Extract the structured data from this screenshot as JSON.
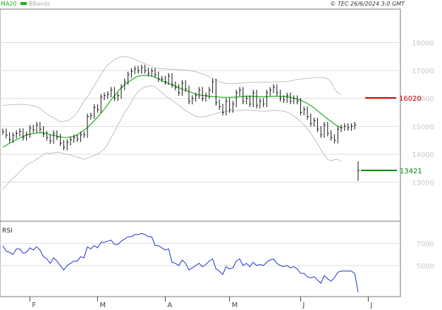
{
  "header": {
    "ma_label": "MA20",
    "bb_label": "BBands",
    "copyright": "© TEC 26/6/2024 3:0 GMT"
  },
  "colors": {
    "price": "#111111",
    "ma": "#1fb01f",
    "bands": "#c0c0c0",
    "rsi": "#2233cc",
    "resistance": "#cc0000",
    "support": "#008800",
    "grid": "#dddddd",
    "panel_border": "#777777"
  },
  "chart_data": [
    {
      "type": "line",
      "panel": "price",
      "y_ticks": [
        13000,
        14000,
        15000,
        16000,
        17000,
        18000
      ],
      "y_tick_labels": [
        "13000",
        "14000",
        "15000",
        "16000",
        "17000",
        "18000"
      ],
      "ylim": [
        11600,
        19200
      ],
      "month_labels": [
        {
          "label": "F",
          "index": 8
        },
        {
          "label": "M",
          "index": 28
        },
        {
          "label": "A",
          "index": 48
        },
        {
          "label": "M",
          "index": 67
        },
        {
          "label": "J",
          "index": 88
        },
        {
          "label": "J",
          "index": 108
        }
      ],
      "close": [
        14810,
        14680,
        14520,
        14670,
        14750,
        14820,
        14600,
        14700,
        14940,
        14880,
        15050,
        14900,
        14720,
        14600,
        14480,
        14750,
        14620,
        14400,
        14250,
        14430,
        14520,
        14600,
        14550,
        14700,
        14700,
        15350,
        15380,
        15680,
        15600,
        16050,
        16100,
        16150,
        16300,
        16020,
        16100,
        16400,
        16600,
        16850,
        16980,
        17060,
        17000,
        17100,
        17000,
        16900,
        16980,
        16850,
        16700,
        16700,
        16600,
        16800,
        16500,
        16400,
        16200,
        16550,
        16350,
        15900,
        16000,
        16100,
        16300,
        16000,
        16100,
        16300,
        16600,
        15850,
        15700,
        15500,
        15900,
        15600,
        15800,
        16200,
        16300,
        15900,
        16000,
        15800,
        16200,
        15750,
        15900,
        15800,
        16200,
        16300,
        16400,
        16200,
        16000,
        15950,
        16100,
        15900,
        16000,
        15900,
        15500,
        15600,
        15350,
        15100,
        15200,
        14900,
        14700,
        15050,
        14750,
        14600,
        14500,
        14900,
        14950,
        15000,
        14950,
        15000,
        15050,
        13421
      ],
      "ma20": [
        14250,
        14320,
        14400,
        14460,
        14520,
        14580,
        14640,
        14690,
        14720,
        14740,
        14760,
        14770,
        14770,
        14750,
        14700,
        14680,
        14650,
        14620,
        14600,
        14600,
        14620,
        14640,
        14700,
        14780,
        14860,
        14950,
        15080,
        15200,
        15330,
        15470,
        15620,
        15780,
        15950,
        16100,
        16250,
        16380,
        16500,
        16580,
        16660,
        16740,
        16800,
        16820,
        16830,
        16820,
        16800,
        16760,
        16700,
        16640,
        16580,
        16530,
        16490,
        16440,
        16390,
        16340,
        16290,
        16250,
        16200,
        16160,
        16130,
        16110,
        16090,
        16080,
        16070,
        16060,
        16050,
        16040,
        16040,
        16040,
        16045,
        16050,
        16060,
        16070,
        16080,
        16080,
        16080,
        16070,
        16060,
        16060,
        16060,
        16070,
        16080,
        16080,
        16080,
        16070,
        16060,
        16040,
        16010,
        15980,
        15940,
        15880,
        15820,
        15740,
        15660,
        15560,
        15460,
        15360,
        15260,
        15180,
        15080,
        15010,
        14950
      ],
      "upper_band": [
        15750,
        15760,
        15770,
        15780,
        15790,
        15790,
        15790,
        15770,
        15760,
        15740,
        15700,
        15640,
        15550,
        15450,
        15370,
        15310,
        15230,
        15170,
        15180,
        15200,
        15260,
        15350,
        15500,
        15700,
        15900,
        16050,
        16250,
        16450,
        16650,
        16850,
        17050,
        17200,
        17300,
        17400,
        17450,
        17500,
        17500,
        17480,
        17450,
        17400,
        17350,
        17300,
        17250,
        17200,
        17150,
        17100,
        17080,
        17070,
        17060,
        17050,
        17050,
        17040,
        17030,
        17020,
        17020,
        17000,
        16980,
        16960,
        16920,
        16880,
        16830,
        16770,
        16720,
        16670,
        16600,
        16560,
        16540,
        16530,
        16530,
        16540,
        16550,
        16560,
        16570,
        16580,
        16580,
        16580,
        16580,
        16580,
        16580,
        16580,
        16580,
        16590,
        16600,
        16600,
        16610,
        16630,
        16650,
        16680,
        16700,
        16700,
        16720,
        16730,
        16740,
        16750,
        16750,
        16740,
        16700,
        16600,
        16350,
        16200,
        16150
      ],
      "lower_band": [
        12750,
        12880,
        13030,
        13140,
        13250,
        13370,
        13490,
        13610,
        13680,
        13740,
        13820,
        13900,
        13990,
        14050,
        14030,
        14050,
        14070,
        14070,
        14020,
        14000,
        13980,
        13930,
        13900,
        13860,
        13820,
        13850,
        13910,
        13950,
        14010,
        14090,
        14190,
        14360,
        14600,
        14800,
        15050,
        15260,
        15500,
        15680,
        15870,
        16080,
        16250,
        16340,
        16410,
        16440,
        16450,
        16420,
        16320,
        16210,
        16100,
        16010,
        15930,
        15840,
        15750,
        15660,
        15560,
        15500,
        15420,
        15360,
        15340,
        15340,
        15350,
        15390,
        15420,
        15450,
        15500,
        15520,
        15540,
        15550,
        15560,
        15560,
        15570,
        15580,
        15590,
        15580,
        15580,
        15560,
        15540,
        15540,
        15540,
        15560,
        15580,
        15570,
        15560,
        15540,
        15510,
        15450,
        15370,
        15280,
        15180,
        15060,
        14920,
        14750,
        14580,
        14370,
        14170,
        13980,
        13820,
        13760,
        13810,
        13820,
        13750
      ],
      "resistance": {
        "value": 16020,
        "label": "16020"
      },
      "support": {
        "value": 13421,
        "label": "13421"
      }
    },
    {
      "type": "line",
      "panel": "rsi",
      "title": "RSI",
      "y_ticks": [
        50,
        70
      ],
      "y_tick_labels": [
        "5000",
        "7000"
      ],
      "ylim": [
        22,
        90
      ],
      "values": [
        68,
        63,
        62,
        60,
        65,
        65,
        61,
        62,
        66,
        64,
        67,
        64,
        58,
        56,
        52,
        57,
        54,
        50,
        46,
        50,
        52,
        54,
        54,
        58,
        57,
        67,
        65,
        68,
        66,
        71,
        71,
        72,
        73,
        69,
        69,
        72,
        74,
        76,
        76,
        78,
        78,
        79,
        78,
        76,
        76,
        68,
        68,
        66,
        64,
        65,
        53,
        52,
        50,
        55,
        52,
        46,
        48,
        50,
        52,
        49,
        51,
        54,
        56,
        47,
        45,
        42,
        49,
        47,
        48,
        54,
        56,
        50,
        52,
        49,
        53,
        50,
        51,
        50,
        53,
        55,
        56,
        52,
        50,
        49,
        50,
        48,
        49,
        47,
        43,
        43,
        40,
        39,
        40,
        37,
        34,
        41,
        38,
        36,
        39,
        44,
        45,
        45,
        45,
        45,
        43,
        26
      ]
    }
  ]
}
